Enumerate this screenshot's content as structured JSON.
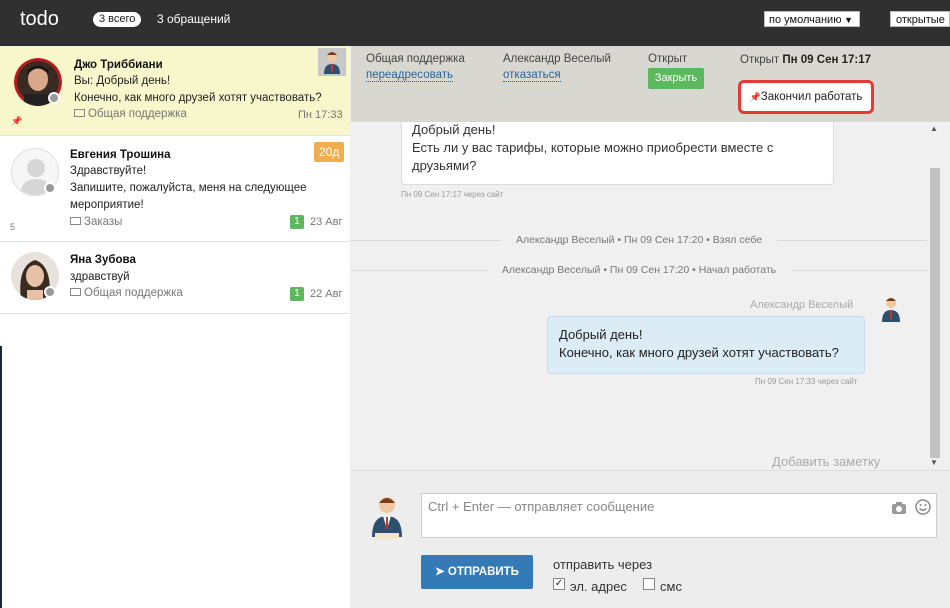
{
  "app": {
    "logo": "todo"
  },
  "topbar": {
    "total_badge": "3 всего",
    "total_text": "3 обращений",
    "sort_value": "по умолчанию",
    "filter_value": "открытые"
  },
  "conversations": [
    {
      "name": "Джо Триббиани",
      "line1": "Вы: Добрый день!",
      "line2": "Конечно, как много друзей хотят участвовать?",
      "dept": "Общая поддержка",
      "time": "Пн 17:33"
    },
    {
      "name": "Евгения Трошина",
      "line1": "Здравствуйте!",
      "line2": "Запишите, пожалуйста, меня на следующее",
      "line3": "мероприятие!",
      "dept": "Заказы",
      "time": "23 Авг",
      "badge": "1",
      "days": "20д",
      "side_num": "5"
    },
    {
      "name": "Яна Зубова",
      "line1": "здравствуй",
      "dept": "Общая поддержка",
      "time": "22 Авг",
      "badge": "1"
    }
  ],
  "header": {
    "dept_label": "Общая поддержка",
    "redirect_link": "переадресовать",
    "agent_label": "Александр Веселый",
    "decline_link": "отказаться",
    "status_label": "Открыт",
    "close_button": "Закрыть",
    "opened_prefix": "Открыт",
    "opened_time": "Пн 09 Сен 17:17",
    "finish_button": "Закончил работать"
  },
  "chat": {
    "incoming": {
      "line1": "Добрый день!",
      "line2": "Есть ли у вас тарифы, которые можно приобрести вместе с",
      "line3": "друзьями?",
      "meta": "Пн 09 Сен 17:17 через сайт"
    },
    "system1": "Александр Веселый • Пн 09 Сен 17:20 • Взял себе",
    "system2": "Александр Веселый • Пн 09 Сен 17:20 • Начал работать",
    "agent_name": "Александр Веселый",
    "outgoing": {
      "line1": "Добрый день!",
      "line2": "Конечно, как много друзей хотят участвовать?",
      "meta": "Пн 09 Сен 17:33 через сайт"
    },
    "add_note": "Добавить заметку"
  },
  "composer": {
    "placeholder": "Ctrl + Enter — отправляет сообщение",
    "send_button": "ОТПРАВИТЬ",
    "via_label": "отправить через",
    "email_label": "эл. адрес",
    "email_checked": true,
    "sms_label": "смс",
    "sms_checked": false
  },
  "colors": {
    "topbar": "#303030",
    "active_conversation": "#f8f6cb",
    "header_bg": "#d8d8d1",
    "close_green": "#5cb85c",
    "send_blue": "#337ab7",
    "highlight_red": "#e53935",
    "outgoing_bubble": "#dcecf7",
    "days_badge": "#f0ad4e"
  },
  "icons": [
    "pin-icon",
    "envelope-icon",
    "camera-icon",
    "smile-icon",
    "paper-plane-icon",
    "chevron-down-icon",
    "checkbox-icon"
  ]
}
